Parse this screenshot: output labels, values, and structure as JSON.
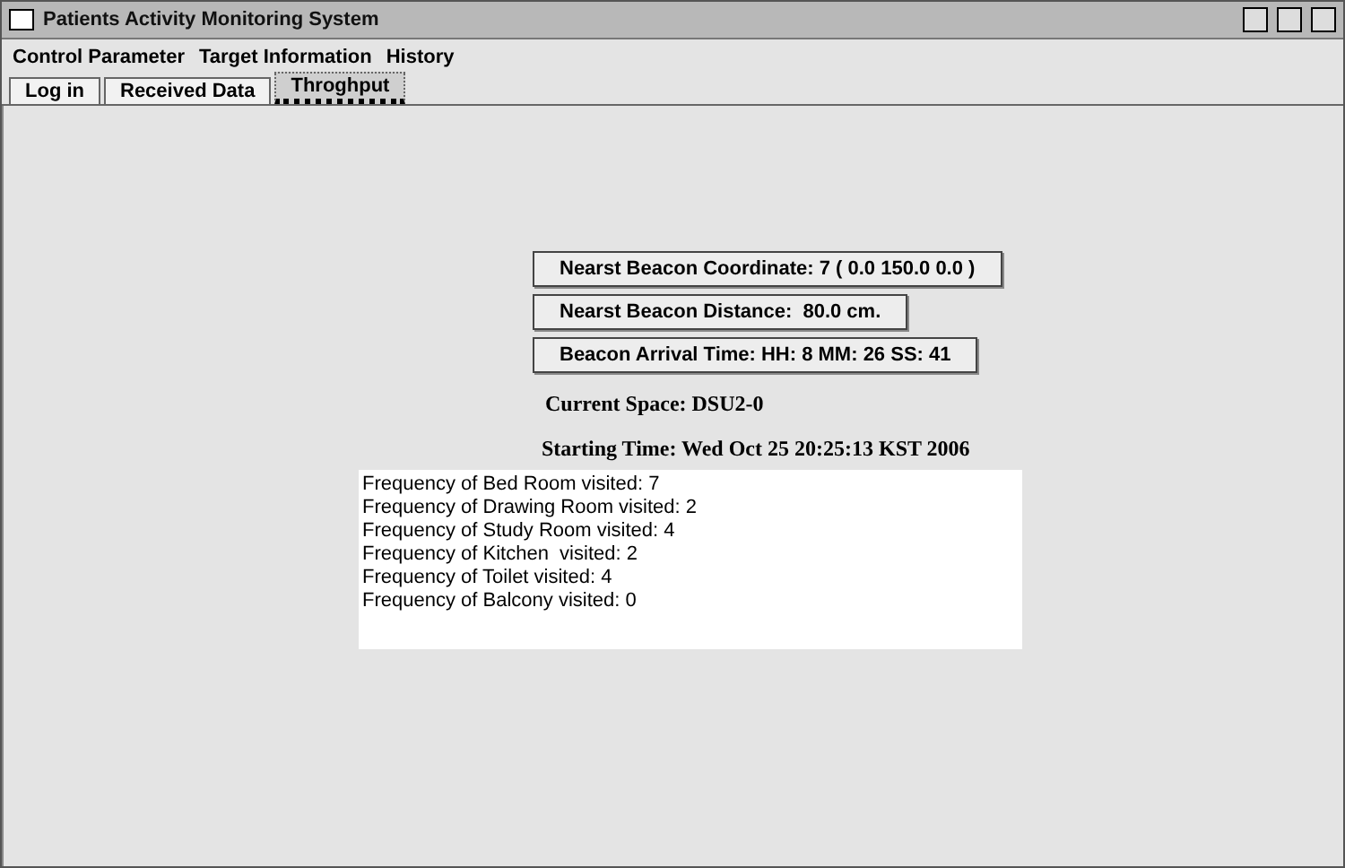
{
  "window": {
    "title": "Patients Activity Monitoring System"
  },
  "menu": [
    "Control Parameter",
    "Target Information",
    "History"
  ],
  "tabs": [
    {
      "label": "Log in",
      "selected": false
    },
    {
      "label": "Received Data",
      "selected": false
    },
    {
      "label": "Throghput",
      "selected": true
    }
  ],
  "beacon_buttons": [
    "Nearst Beacon Coordinate: 7 ( 0.0 150.0 0.0 )",
    "Nearst Beacon Distance:  80.0 cm.",
    "Beacon Arrival Time: HH: 8 MM: 26 SS: 41"
  ],
  "current_space": "Current Space: DSU2-0",
  "starting_time": "Starting Time:  Wed Oct 25 20:25:13 KST 2006",
  "frequency_lines": [
    "Frequency of Bed Room visited: 7",
    "Frequency of Drawing Room visited: 2",
    "Frequency of Study Room visited: 4",
    "Frequency of Kitchen  visited: 2",
    "Frequency of Toilet visited: 4",
    "Frequency of Balcony visited: 0"
  ]
}
